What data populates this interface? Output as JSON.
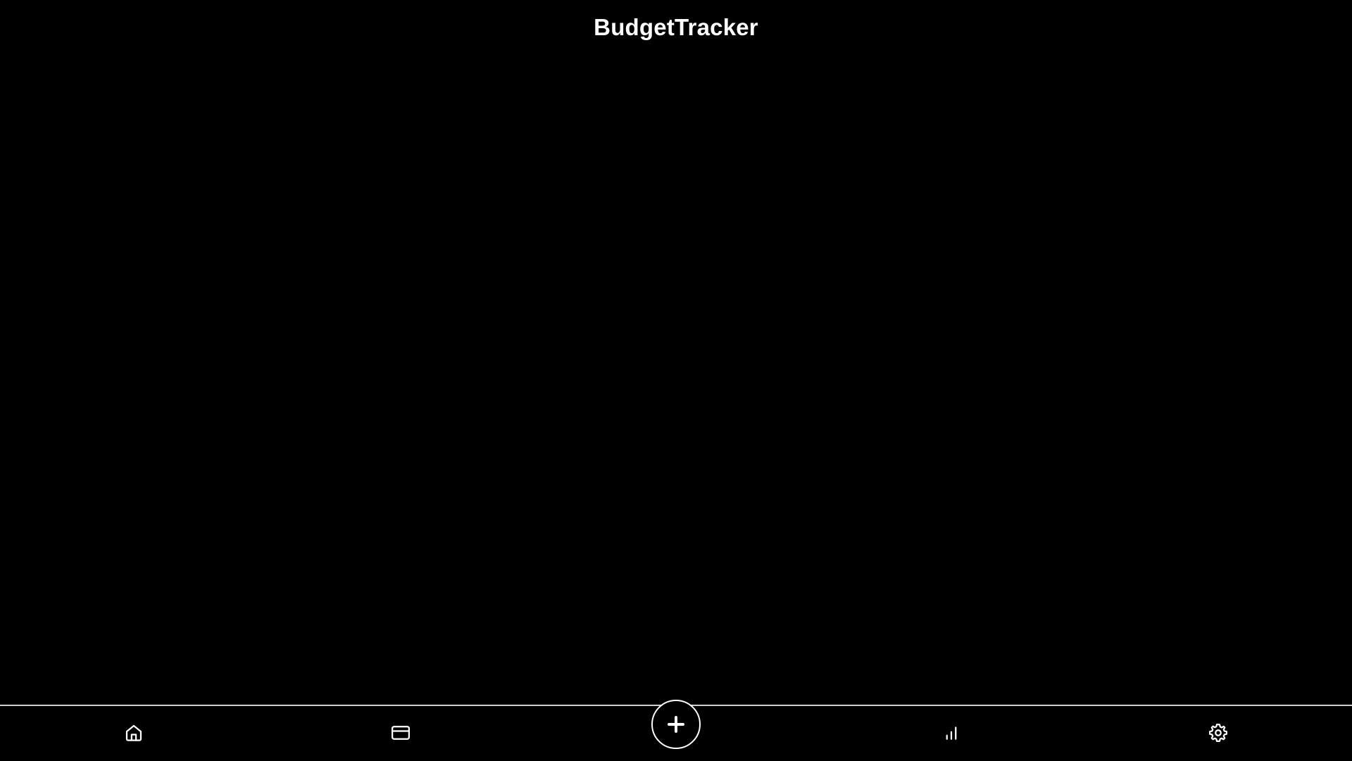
{
  "app": {
    "title": "BudgetTracker"
  },
  "theme": {
    "background": "#000000",
    "foreground": "#ffffff",
    "divider": "#cfcfcf"
  },
  "bottom_nav": {
    "items": [
      {
        "icon": "home-icon"
      },
      {
        "icon": "credit-card-icon"
      },
      {
        "icon": "plus-icon"
      },
      {
        "icon": "bar-chart-icon"
      },
      {
        "icon": "gear-icon"
      }
    ]
  }
}
